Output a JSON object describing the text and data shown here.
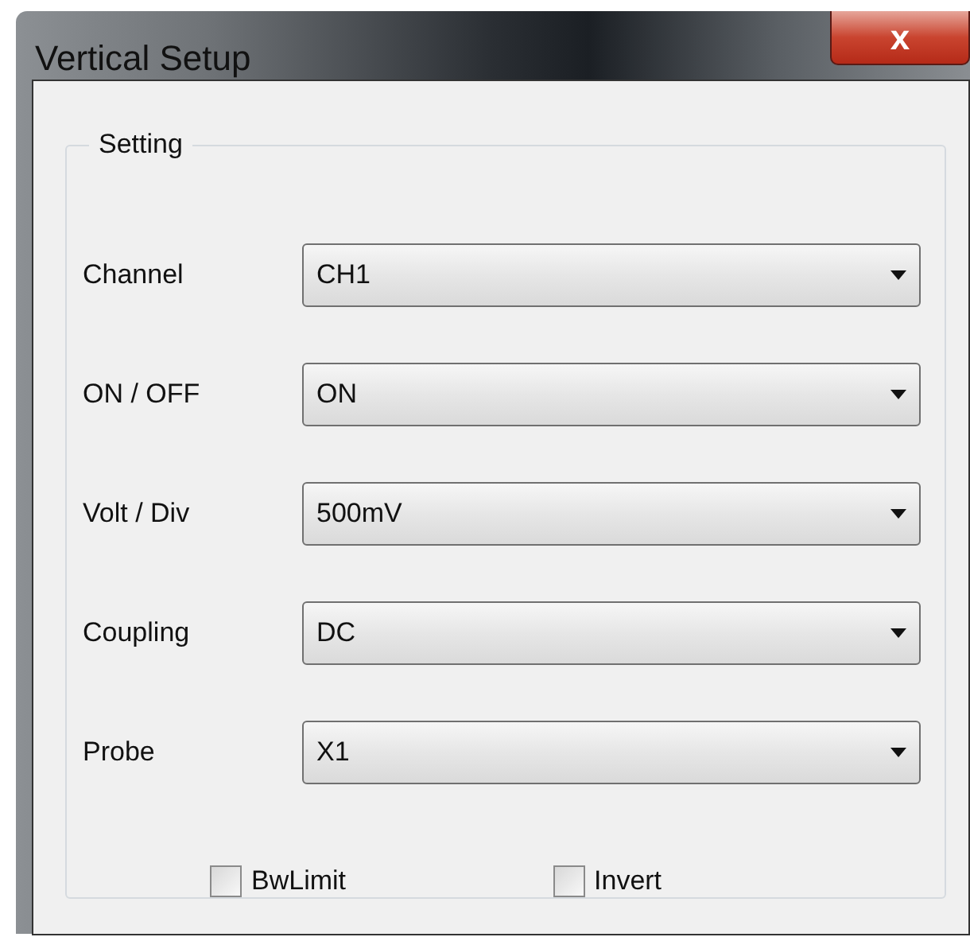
{
  "window": {
    "title": "Vertical Setup",
    "close": "x"
  },
  "group": {
    "title": "Setting"
  },
  "fields": [
    {
      "label": "Channel",
      "value": "CH1"
    },
    {
      "label": "ON / OFF",
      "value": "ON"
    },
    {
      "label": "Volt / Div",
      "value": "500mV"
    },
    {
      "label": "Coupling",
      "value": "DC"
    },
    {
      "label": "Probe",
      "value": "X1"
    }
  ],
  "checkboxes": [
    {
      "label": "BwLimit",
      "checked": false
    },
    {
      "label": "Invert",
      "checked": false
    }
  ]
}
